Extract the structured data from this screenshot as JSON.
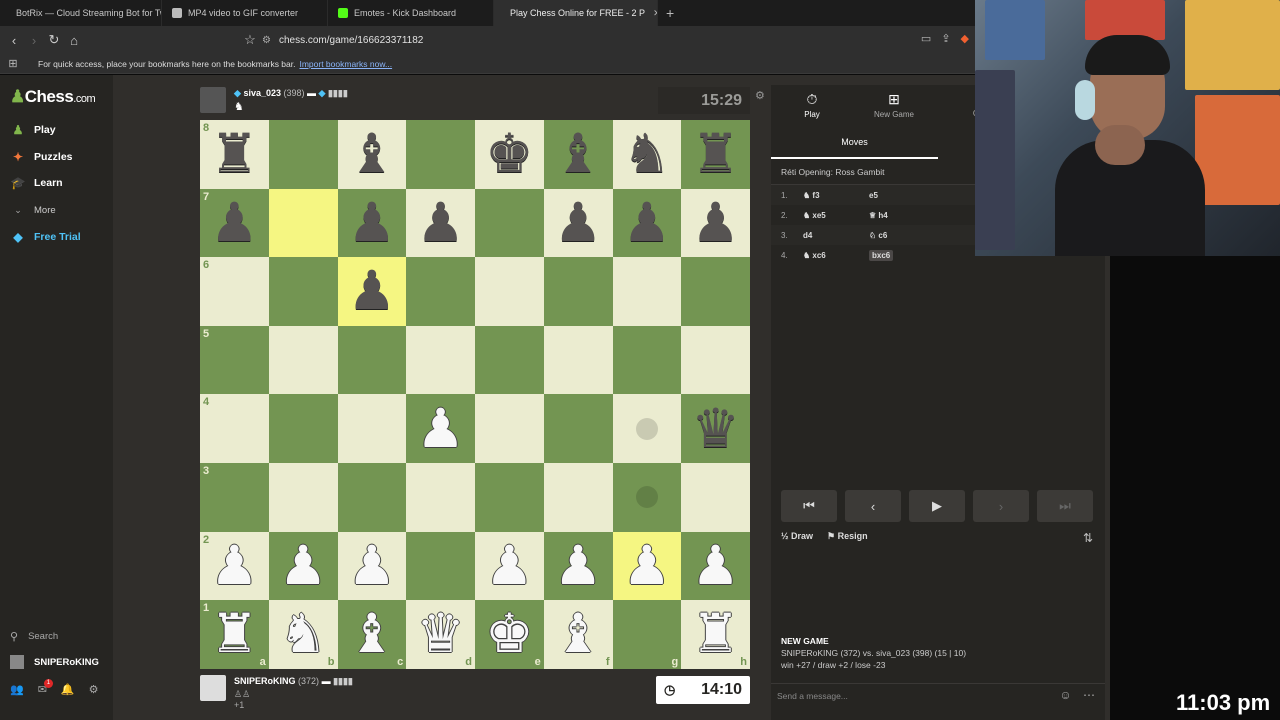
{
  "browser": {
    "tabs": [
      {
        "title": "BotRix — Cloud Streaming Bot for Tw",
        "icon": "botrix-icon",
        "color": "#cfcfcf",
        "active": false
      },
      {
        "title": "MP4 video to GIF converter",
        "icon": "ezgif-icon",
        "color": "#bbbbbb",
        "active": false
      },
      {
        "title": "Emotes - Kick Dashboard",
        "icon": "kick-icon",
        "color": "#53fc18",
        "active": false
      },
      {
        "title": "Play Chess Online for FREE - 2 P",
        "icon": "chess-icon",
        "color": "#81b64c",
        "active": true
      }
    ],
    "url": "chess.com/game/166623371182",
    "bookmarks_text": "For quick access, place your bookmarks here on the bookmarks bar.",
    "bookmarks_link": "Import bookmarks now..."
  },
  "sidebar": {
    "logo": "Chess",
    "logo_suffix": ".com",
    "items": [
      {
        "label": "Play",
        "icon": "play-icon",
        "color": "#81b64c"
      },
      {
        "label": "Puzzles",
        "icon": "puzzle-icon",
        "color": "#f2773b"
      },
      {
        "label": "Learn",
        "icon": "learn-icon",
        "color": "#4fa3e0"
      },
      {
        "label": "More",
        "icon": "chevron-down-icon",
        "color": "#aaaaaa"
      },
      {
        "label": "Free Trial",
        "icon": "diamond-icon",
        "color": "#4fc3f7"
      }
    ],
    "search": "Search",
    "user": "SNIPERoKING",
    "mail_badge": "1"
  },
  "game": {
    "top_player": {
      "name": "siva_023",
      "rating": "(398)",
      "clock": "15:29"
    },
    "bottom_player": {
      "name": "SNIPERoKING",
      "rating": "(372)",
      "clock": "14:10",
      "captured": "+1"
    },
    "files": [
      "a",
      "b",
      "c",
      "d",
      "e",
      "f",
      "g",
      "h"
    ],
    "ranks": [
      "8",
      "7",
      "6",
      "5",
      "4",
      "3",
      "2",
      "1"
    ],
    "board": [
      [
        "bR",
        "",
        "bB",
        "",
        "bK",
        "bB",
        "bN",
        "bR"
      ],
      [
        "bP",
        "",
        "bP",
        "bP",
        "",
        "bP",
        "bP",
        "bP"
      ],
      [
        "",
        "",
        "bP",
        "",
        "",
        "",
        "",
        ""
      ],
      [
        "",
        "",
        "",
        "",
        "",
        "",
        "",
        ""
      ],
      [
        "",
        "",
        "",
        "wP",
        "",
        "",
        "",
        "bQ"
      ],
      [
        "",
        "",
        "",
        "",
        "",
        "",
        "",
        ""
      ],
      [
        "wP",
        "wP",
        "wP",
        "",
        "wP",
        "wP",
        "wP",
        "wP"
      ],
      [
        "wR",
        "wN",
        "wB",
        "wQ",
        "wK",
        "wB",
        "",
        "wR"
      ]
    ],
    "highlights": [
      [
        1,
        1
      ],
      [
        2,
        2
      ],
      [
        6,
        6
      ]
    ],
    "hints": [
      [
        4,
        6
      ],
      [
        5,
        6
      ]
    ]
  },
  "panel": {
    "tabs": [
      {
        "label": "Play",
        "icon": "stopwatch-icon"
      },
      {
        "label": "New Game",
        "icon": "plus-icon"
      },
      {
        "label": "G",
        "icon": "games-icon"
      }
    ],
    "moves_tab": "Moves",
    "opening": "Réti Opening: Ross Gambit",
    "moves": [
      {
        "num": "1.",
        "white": "f3",
        "white_piece": "♞",
        "black": "e5",
        "black_piece": ""
      },
      {
        "num": "2.",
        "white": "xe5",
        "white_piece": "♞",
        "black": "h4",
        "black_piece": "♕"
      },
      {
        "num": "3.",
        "white": "d4",
        "white_piece": "",
        "black": "c6",
        "black_piece": "♘"
      },
      {
        "num": "4.",
        "white": "xc6",
        "white_piece": "♞",
        "black": "bxc6",
        "black_piece": ""
      }
    ],
    "draw": "Draw",
    "resign": "Resign",
    "new_game_title": "NEW GAME",
    "new_game_line1": "SNIPERoKING (372) vs. siva_023 (398) (15 | 10)",
    "new_game_line2": "win +27 / draw +2 / lose -23",
    "chat_placeholder": "Send a message..."
  },
  "overlay": {
    "time": "11:03 pm"
  }
}
